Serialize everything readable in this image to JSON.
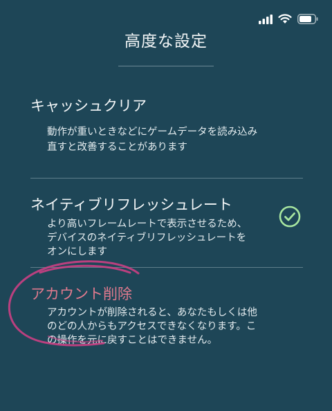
{
  "header": {
    "title": "高度な設定"
  },
  "status_bar": {
    "icons": [
      "signal-icon",
      "wifi-icon",
      "battery-icon"
    ]
  },
  "options": [
    {
      "title": "キャッシュクリア",
      "desc_lines": [
        "動作が重いときなどにゲームデータを読み込み",
        "直すと改善することがあります"
      ]
    },
    {
      "title": "ネイティブリフレッシュレート",
      "desc_lines": [
        "より高いフレームレートで表示させるため、",
        "デバイスのネイティブリフレッシュレートを",
        "オンにします"
      ],
      "checked": true
    },
    {
      "title": "アカウント削除",
      "desc_lines": [
        "アカウントが削除されると、あなたもしくは他",
        "のどの人からもアクセスできなくなります。こ",
        "の操作を元に戻すことはできません。"
      ]
    }
  ],
  "colors": {
    "background": "#1e4657",
    "danger": "#e07a8e",
    "check": "#a8e6a0",
    "annotation": "#d63f86"
  }
}
